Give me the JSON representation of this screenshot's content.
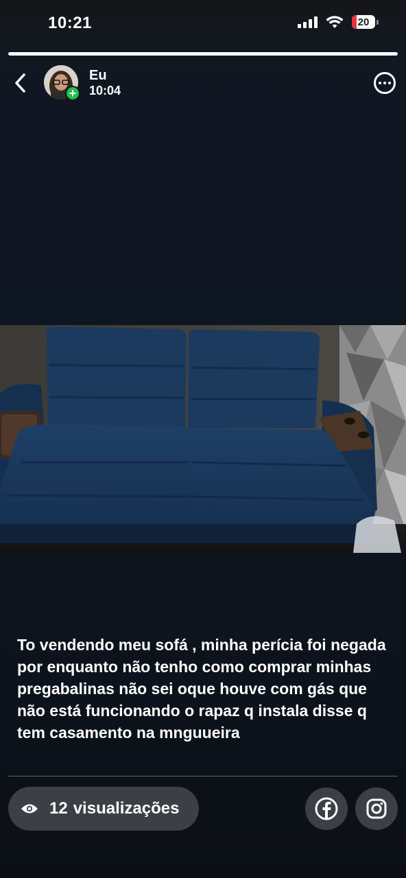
{
  "status_bar": {
    "time": "10:21",
    "battery_level": "20",
    "battery_color": "#e5343a"
  },
  "story": {
    "progress": 1.0,
    "author": {
      "name": "Eu",
      "posted_time": "10:04"
    },
    "caption": "To vendendo meu sofá , minha perícia foi negada por enquanto não tenho como comprar minhas pregabalinas não sei oque houve com gás que não está funcionando o rapaz q instala disse q tem casamento na mnguueira",
    "views": {
      "count": "12",
      "label": "visualizações",
      "icon": "eye-icon"
    },
    "share": [
      {
        "name": "facebook",
        "icon": "facebook-icon"
      },
      {
        "name": "instagram",
        "icon": "instagram-icon"
      }
    ]
  },
  "colors": {
    "background": "#0e1520",
    "accent_green": "#1fbf4e",
    "sofa_blue": "#1c3a5e"
  }
}
